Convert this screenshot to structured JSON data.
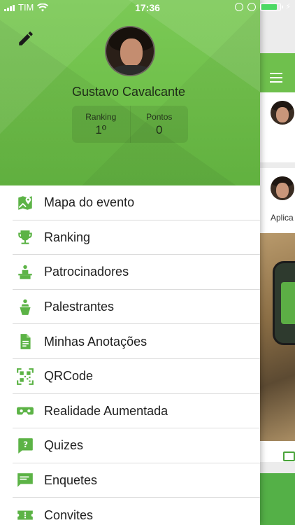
{
  "status_bar": {
    "carrier": "TIM",
    "time": "17:36",
    "charging_symbol": "⚡"
  },
  "profile": {
    "name": "Gustavo Cavalcante",
    "stats": [
      {
        "label": "Ranking",
        "value": "1º"
      },
      {
        "label": "Pontos",
        "value": "0"
      }
    ]
  },
  "menu": {
    "items": [
      {
        "label": "Mapa do evento",
        "icon": "map-pin-icon"
      },
      {
        "label": "Ranking",
        "icon": "trophy-icon"
      },
      {
        "label": "Patrocinadores",
        "icon": "sponsor-podium-icon"
      },
      {
        "label": "Palestrantes",
        "icon": "speaker-icon"
      },
      {
        "label": "Minhas Anotações",
        "icon": "document-icon"
      },
      {
        "label": "QRCode",
        "icon": "qrcode-icon"
      },
      {
        "label": "Realidade Aumentada",
        "icon": "vr-headset-icon"
      },
      {
        "label": "Quizes",
        "icon": "quiz-icon"
      },
      {
        "label": "Enquetes",
        "icon": "chat-icon"
      },
      {
        "label": "Convites",
        "icon": "ticket-icon"
      }
    ]
  },
  "background_feed": {
    "post_caption": "Aplica"
  },
  "colors": {
    "brand_green": "#6ebf49",
    "icon_green": "#5cb346",
    "battery_green": "#4cd964"
  }
}
